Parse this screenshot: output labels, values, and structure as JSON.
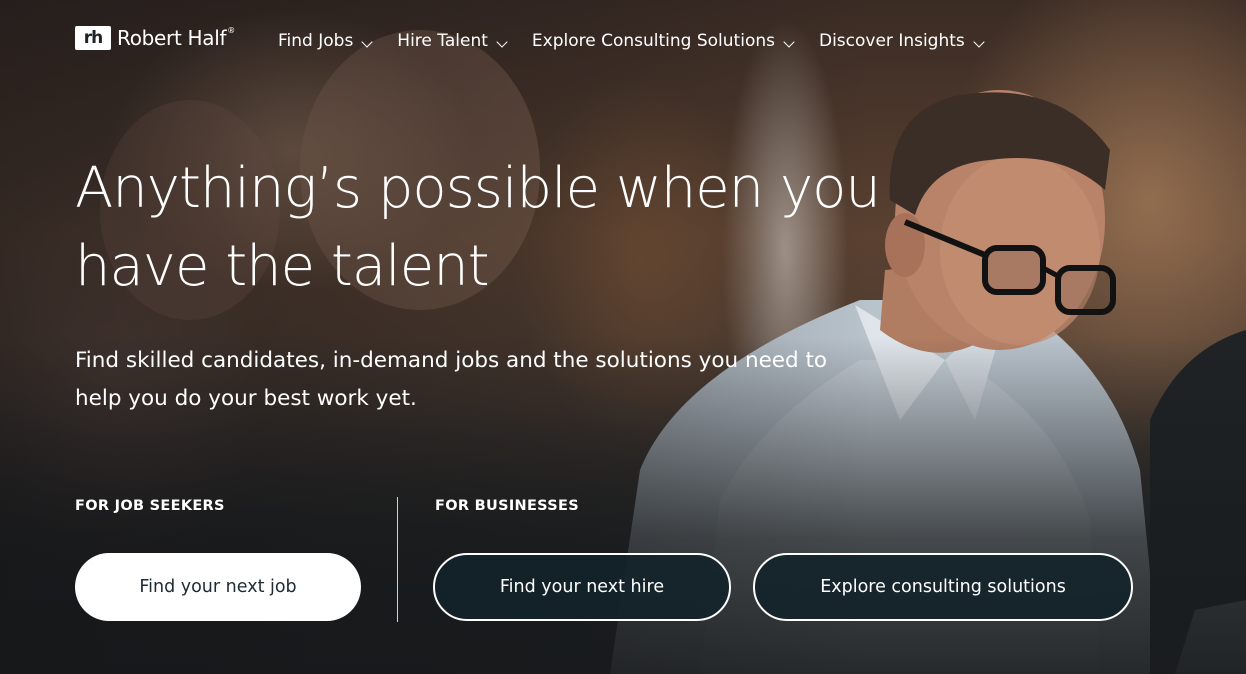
{
  "brand": {
    "mark": "rh",
    "name": "Robert Half",
    "tm": "®"
  },
  "nav": {
    "items": [
      {
        "label": "Find Jobs",
        "icon": "chevron-down-icon"
      },
      {
        "label": "Hire Talent",
        "icon": "chevron-down-icon"
      },
      {
        "label": "Explore Consulting Solutions",
        "icon": "chevron-down-icon"
      },
      {
        "label": "Discover Insights",
        "icon": "chevron-down-icon"
      }
    ]
  },
  "hero": {
    "headline_line1": "Anything’s possible when you",
    "headline_line2": "have the talent",
    "subhead_line1": "Find skilled candidates, in-demand jobs and the solutions you need to",
    "subhead_line2": "help you do your best work yet."
  },
  "job_seekers": {
    "label": "FOR JOB SEEKERS",
    "button": "Find your next job"
  },
  "businesses": {
    "label": "FOR BUSINESSES",
    "hire_button": "Find your next hire",
    "consulting_button": "Explore consulting solutions"
  },
  "colors": {
    "button_dark": "#12222a",
    "button_light": "#ffffff",
    "text": "#ffffff"
  }
}
